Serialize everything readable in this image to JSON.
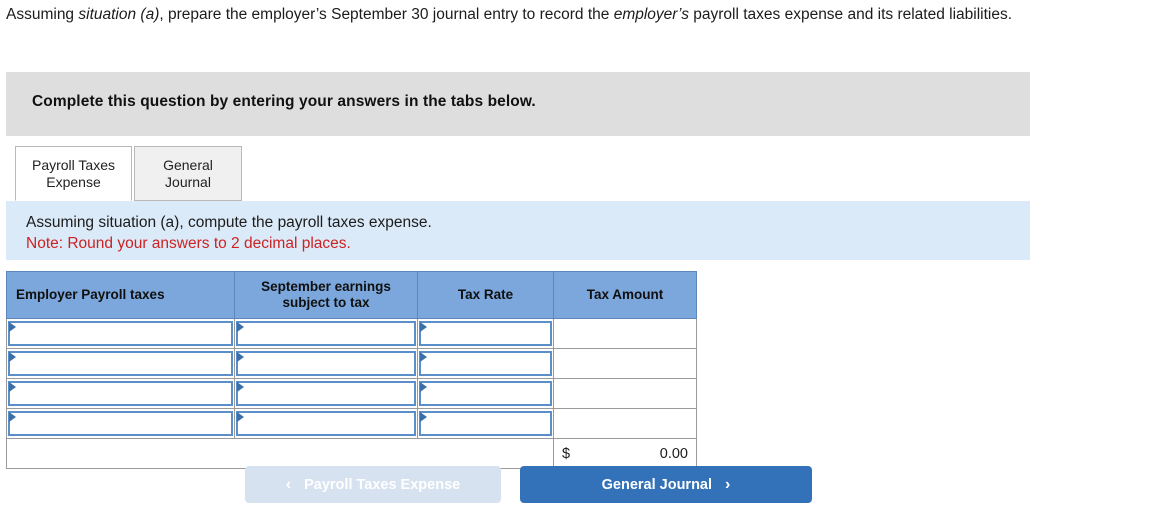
{
  "prompt": {
    "part1": "Assuming ",
    "italic1": "situation (a)",
    "part2": ", prepare the employer’s September 30 journal entry to record the ",
    "italic2": "employer’s",
    "part3": " payroll taxes expense and its related liabilities."
  },
  "banner": {
    "text": "Complete this question by entering your answers in the tabs below."
  },
  "tabs": [
    {
      "label": "Payroll Taxes Expense",
      "active": true
    },
    {
      "label": "General Journal",
      "active": false
    }
  ],
  "instructions": {
    "line1": "Assuming situation (a), compute the payroll taxes expense.",
    "note": "Note: Round your answers to 2 decimal places."
  },
  "table": {
    "headers": [
      "Employer Payroll taxes",
      "September earnings subject to tax",
      "Tax Rate",
      "Tax Amount"
    ],
    "rows": [
      {
        "tax": "",
        "earnings": "",
        "rate": "",
        "amount": ""
      },
      {
        "tax": "",
        "earnings": "",
        "rate": "",
        "amount": ""
      },
      {
        "tax": "",
        "earnings": "",
        "rate": "",
        "amount": ""
      },
      {
        "tax": "",
        "earnings": "",
        "rate": "",
        "amount": ""
      }
    ],
    "total": {
      "currency": "$",
      "value": "0.00"
    }
  },
  "footer": {
    "prev_label": "Payroll Taxes Expense",
    "prev_chevron": "‹",
    "next_label": "General Journal",
    "next_chevron": "›"
  },
  "colors": {
    "header_blue": "#7ba7dc",
    "primary_blue": "#3372b8",
    "disabled_blue": "#d6e2ef",
    "band_blue": "#dbeaf8",
    "banner_grey": "#dedede",
    "note_red": "#cc2222"
  }
}
